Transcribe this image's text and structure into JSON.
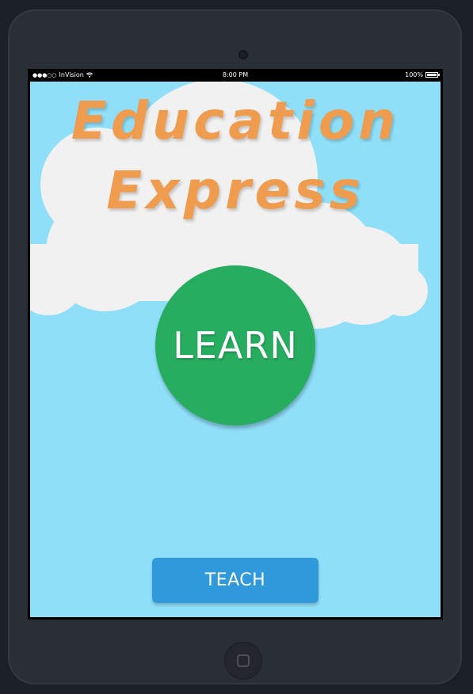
{
  "status_bar": {
    "signal": "●●●○○",
    "carrier": "InVision",
    "wifi_icon": "wifi-icon",
    "time": "8:00 PM",
    "battery": "100%"
  },
  "app": {
    "title_line1": "Education",
    "title_line2": "Express",
    "learn_label": "LEARN",
    "teach_label": "TEACH"
  },
  "colors": {
    "sky": "#8fdff8",
    "cloud": "#f1f1f2",
    "title": "#f09c4f",
    "learn": "#27ad5f",
    "teach": "#2f99db",
    "device": "#2a2e36"
  }
}
